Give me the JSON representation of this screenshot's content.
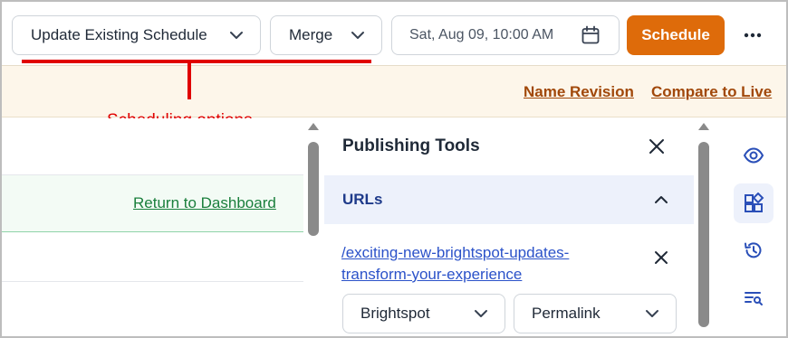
{
  "toolbar": {
    "schedule_mode": "Update Existing Schedule",
    "merge_mode": "Merge",
    "datetime": "Sat, Aug 09, 10:00 AM",
    "schedule_button": "Schedule"
  },
  "annotation": {
    "label": "Scheduling options",
    "color": "#e00000"
  },
  "revision_bar": {
    "name_revision": "Name Revision",
    "compare_to_live": "Compare to Live"
  },
  "content": {
    "return_link": "Return to Dashboard"
  },
  "publishing_tools": {
    "title": "Publishing Tools",
    "urls_section": {
      "label": "URLs",
      "url": "/exciting-new-brightspot-updates-transform-your-experience",
      "site": "Brightspot",
      "url_type": "Permalink"
    }
  },
  "right_rail": {
    "icons": [
      "eye-icon",
      "widgets-icon",
      "history-icon",
      "search-list-icon"
    ],
    "active": "widgets-icon"
  },
  "colors": {
    "accent": "#de6b0a",
    "link_brown": "#a1480a",
    "link_green": "#1a7f3c",
    "link_blue": "#2b52c9",
    "icon_blue": "#2a4fb8"
  }
}
